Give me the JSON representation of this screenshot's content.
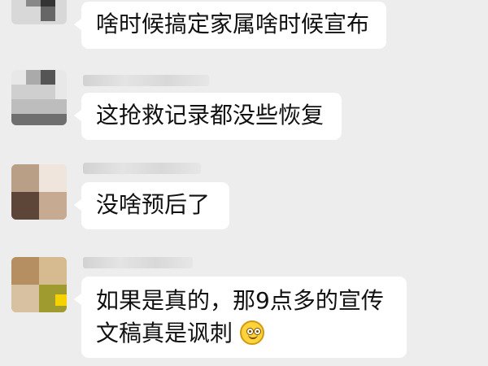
{
  "messages": [
    {
      "text_lines": [
        "啥时候搞定家属啥时候宣布"
      ],
      "sender_name": ""
    },
    {
      "text_lines": [
        "这抢救记录都没些恢复"
      ],
      "sender_name": ""
    },
    {
      "text_lines": [
        "没啥预后了"
      ],
      "sender_name": ""
    },
    {
      "text_lines": [
        "如果是真的，那9点多的宣传",
        "文稿真是讽刺"
      ],
      "sender_name": "",
      "emoji": "dizzy-face-emoji"
    }
  ]
}
